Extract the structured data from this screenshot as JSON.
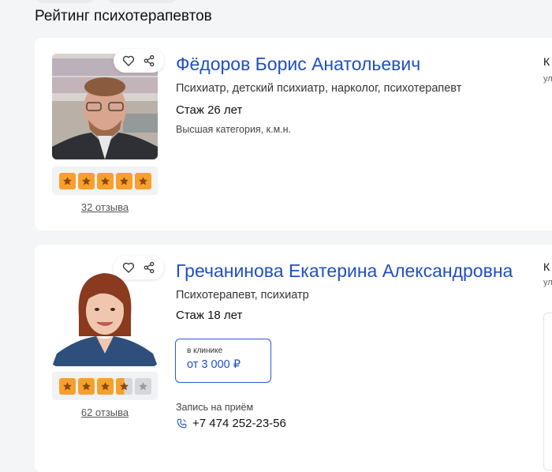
{
  "page": {
    "title": "Рейтинг психотерапевтов"
  },
  "doctors": [
    {
      "name": "Фёдоров Борис Анатольевич",
      "specialty": "Психиатр, детский психиатр, нарколог, психотерапевт",
      "experience": "Стаж 26 лет",
      "category": "Высшая категория, к.м.н.",
      "rating": 5,
      "reviews": "32 отзыва",
      "clipped_top": "К",
      "clipped_sub": "ул"
    },
    {
      "name": "Гречанинова Екатерина Александровна",
      "specialty": "Психотерапевт, психиатр",
      "experience": "Стаж 18 лет",
      "rating": 3.5,
      "reviews": "62 отзыва",
      "price_label": "в клинике",
      "price_value": "от 3 000 ₽",
      "appointment_label": "Запись на приём",
      "phone": "+7 474 252-23-56",
      "clipped_top": "К",
      "clipped_sub": "ул"
    }
  ],
  "colors": {
    "accent": "#1f4fc1",
    "star": "#f7a02d",
    "star_empty": "#d5d7db"
  },
  "icons": [
    "heart-icon",
    "share-icon",
    "star-icon",
    "phone-icon"
  ]
}
